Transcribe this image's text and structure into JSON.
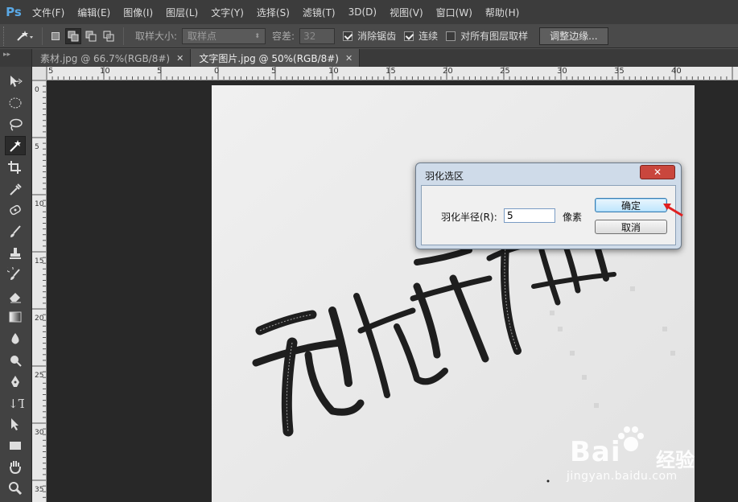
{
  "app": {
    "logo": "Ps"
  },
  "menu": [
    "文件(F)",
    "编辑(E)",
    "图像(I)",
    "图层(L)",
    "文字(Y)",
    "选择(S)",
    "滤镜(T)",
    "3D(D)",
    "视图(V)",
    "窗口(W)",
    "帮助(H)"
  ],
  "options": {
    "sample_size_label": "取样大小:",
    "sample_size_value": "取样点",
    "tolerance_label": "容差:",
    "tolerance_value": "32",
    "antialias_label": "消除锯齿",
    "contiguous_label": "连续",
    "all_layers_label": "对所有图层取样",
    "refine_edge_label": "调整边缘..."
  },
  "tabs": [
    {
      "label": "素材.jpg @ 66.7%(RGB/8#)",
      "active": false
    },
    {
      "label": "文字图片.jpg @ 50%(RGB/8#)",
      "active": true
    }
  ],
  "ruler_top": [
    "5",
    "10",
    "5",
    "0",
    "5",
    "10",
    "15",
    "20",
    "25",
    "30",
    "35",
    "40"
  ],
  "ruler_left": [
    "0",
    "5",
    "10",
    "15",
    "20",
    "25",
    "30",
    "35"
  ],
  "dialog": {
    "title": "羽化选区",
    "close_glyph": "✕",
    "field_label": "羽化半径(R):",
    "field_value": "5",
    "field_unit": "像素",
    "ok_label": "确定",
    "cancel_label": "取消"
  },
  "watermark": {
    "brand": "Bai",
    "sub": "经验",
    "url": "jingyan.baidu.com"
  }
}
